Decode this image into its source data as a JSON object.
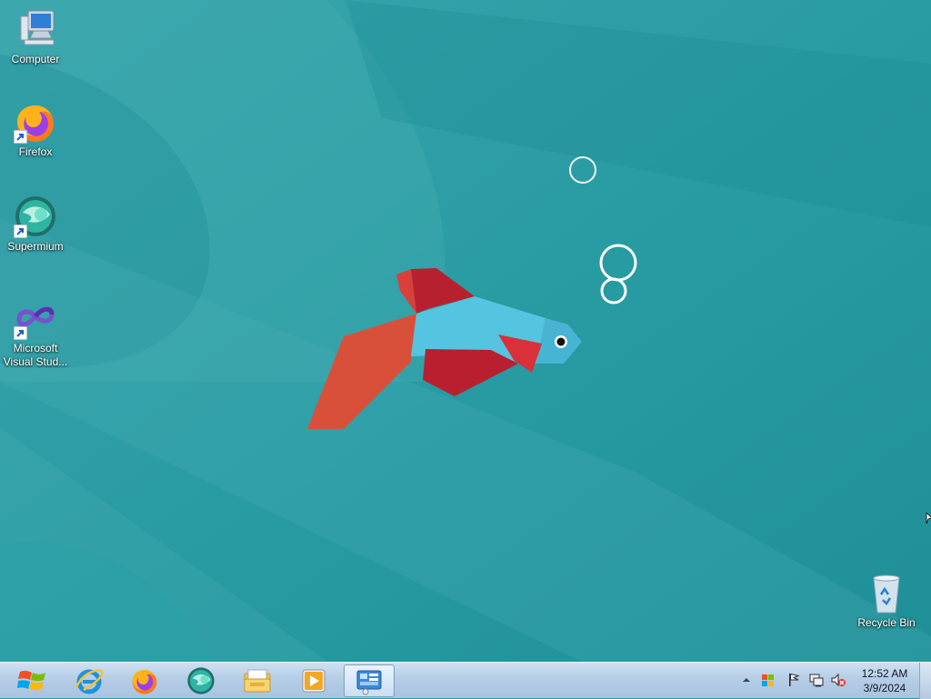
{
  "desktop": {
    "icons": [
      {
        "label": "Computer",
        "icon": "computer-icon"
      },
      {
        "label": "Firefox",
        "icon": "firefox-icon"
      },
      {
        "label": "Supermium",
        "icon": "supermium-icon"
      },
      {
        "label": "Microsoft\nVisual Stud...",
        "icon": "visual-studio-icon"
      },
      {
        "label": "Recycle Bin",
        "icon": "recycle-bin-icon"
      }
    ]
  },
  "taskbar": {
    "start": {
      "icon": "windows-logo-icon"
    },
    "pinned": [
      {
        "icon": "internet-explorer-icon"
      },
      {
        "icon": "firefox-icon"
      },
      {
        "icon": "supermium-icon"
      },
      {
        "icon": "file-explorer-icon"
      },
      {
        "icon": "media-player-icon"
      },
      {
        "icon": "control-panel-icon",
        "active": true
      }
    ],
    "tray": {
      "icons": [
        "show-hidden-icons-icon",
        "windows-flag-icon",
        "action-center-flag-icon",
        "network-icon",
        "volume-muted-icon"
      ],
      "time": "12:52 AM",
      "date": "3/9/2024"
    }
  },
  "colors": {
    "wallpaper_base": "#2b9ba3",
    "taskbar": "#b5cde6",
    "fish_body": "#55c4e0",
    "fish_fin_red": "#b8202f",
    "fish_tail_orange": "#d9503a"
  }
}
